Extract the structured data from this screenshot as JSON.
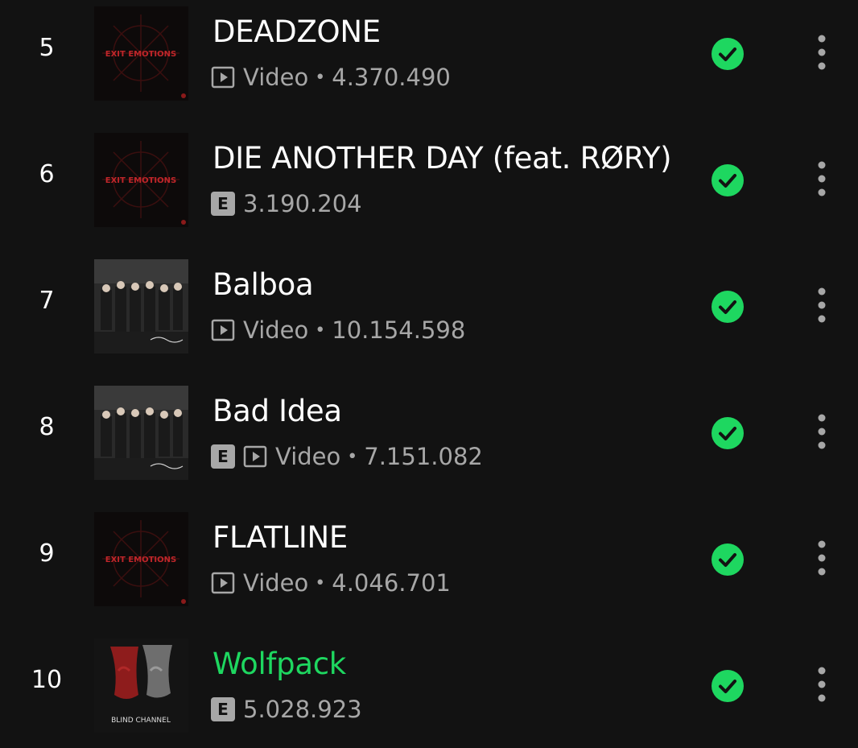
{
  "colors": {
    "background": "#121212",
    "text_primary": "#ffffff",
    "text_secondary": "#a7a7a7",
    "accent_green": "#1ed760"
  },
  "tracks": [
    {
      "rank": "5",
      "title": "DEADZONE",
      "explicit": false,
      "video": true,
      "video_label": "Video",
      "plays": "4.370.490",
      "cover": "exit-emotions-cover",
      "cover_text": "EXIT EMOTIONS",
      "active": false,
      "saved_icon": "check-circle-icon",
      "more_icon": "more-vertical-icon"
    },
    {
      "rank": "6",
      "title": "DIE ANOTHER DAY (feat. RØRY)",
      "explicit": true,
      "explicit_label": "E",
      "video": false,
      "plays": "3.190.204",
      "cover": "exit-emotions-cover",
      "cover_text": "EXIT EMOTIONS",
      "active": false,
      "saved_icon": "check-circle-icon",
      "more_icon": "more-vertical-icon"
    },
    {
      "rank": "7",
      "title": "Balboa",
      "explicit": false,
      "video": true,
      "video_label": "Video",
      "plays": "10.154.598",
      "cover": "band-photo-cover",
      "active": false,
      "saved_icon": "check-circle-icon",
      "more_icon": "more-vertical-icon"
    },
    {
      "rank": "8",
      "title": "Bad Idea",
      "explicit": true,
      "explicit_label": "E",
      "video": true,
      "video_label": "Video",
      "plays": "7.151.082",
      "cover": "band-photo-cover",
      "active": false,
      "saved_icon": "check-circle-icon",
      "more_icon": "more-vertical-icon"
    },
    {
      "rank": "9",
      "title": "FLATLINE",
      "explicit": false,
      "video": true,
      "video_label": "Video",
      "plays": "4.046.701",
      "cover": "exit-emotions-cover",
      "cover_text": "EXIT EMOTIONS",
      "active": false,
      "saved_icon": "check-circle-icon",
      "more_icon": "more-vertical-icon"
    },
    {
      "rank": "10",
      "title": "Wolfpack",
      "explicit": true,
      "explicit_label": "E",
      "video": false,
      "plays": "5.028.923",
      "cover": "blind-channel-cover",
      "cover_text": "BLIND CHANNEL",
      "active": true,
      "saved_icon": "check-circle-icon",
      "more_icon": "more-vertical-icon"
    }
  ]
}
